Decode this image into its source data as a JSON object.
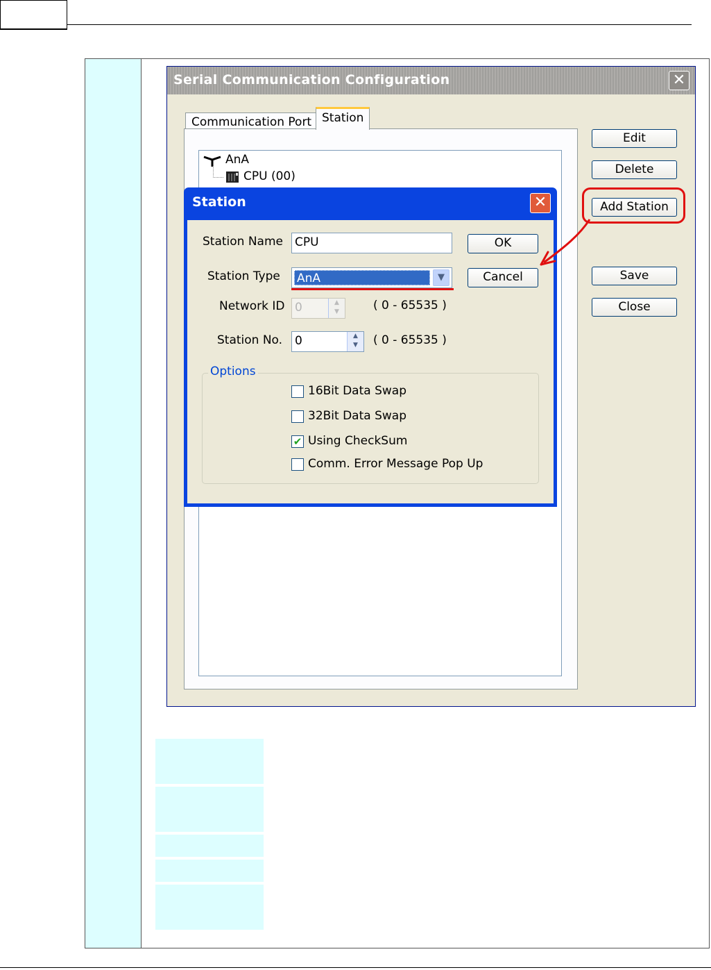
{
  "window": {
    "title": "Serial Communication Configuration",
    "close_glyph": "✕",
    "tabs": [
      {
        "label": "Communication Port"
      },
      {
        "label": "Station"
      }
    ],
    "tree": {
      "root": "AnA",
      "child": "CPU (00)"
    },
    "buttons": {
      "edit": "Edit",
      "delete": "Delete",
      "add_station": "Add Station",
      "save": "Save",
      "close": "Close"
    }
  },
  "dialog": {
    "title": "Station",
    "close_glyph": "✕",
    "station_name_label": "Station Name",
    "station_name_value": "CPU",
    "station_type_label": "Station Type",
    "station_type_value": "AnA",
    "network_id_label": "Network ID",
    "network_id_value": "0",
    "network_id_range": "( 0 - 65535 )",
    "station_no_label": "Station No.",
    "station_no_value": "0",
    "station_no_range": "( 0 - 65535 )",
    "ok": "OK",
    "cancel": "Cancel",
    "options_label": "Options",
    "options": [
      {
        "label": "16Bit Data Swap",
        "checked": false
      },
      {
        "label": "32Bit Data Swap",
        "checked": false
      },
      {
        "label": "Using CheckSum",
        "checked": true
      },
      {
        "label": "Comm. Error Message Pop Up",
        "checked": false
      }
    ]
  },
  "colors": {
    "dialog_titlebar": "#0a44e0",
    "annotation": "#e01010",
    "side_column": "#ddfeff"
  }
}
